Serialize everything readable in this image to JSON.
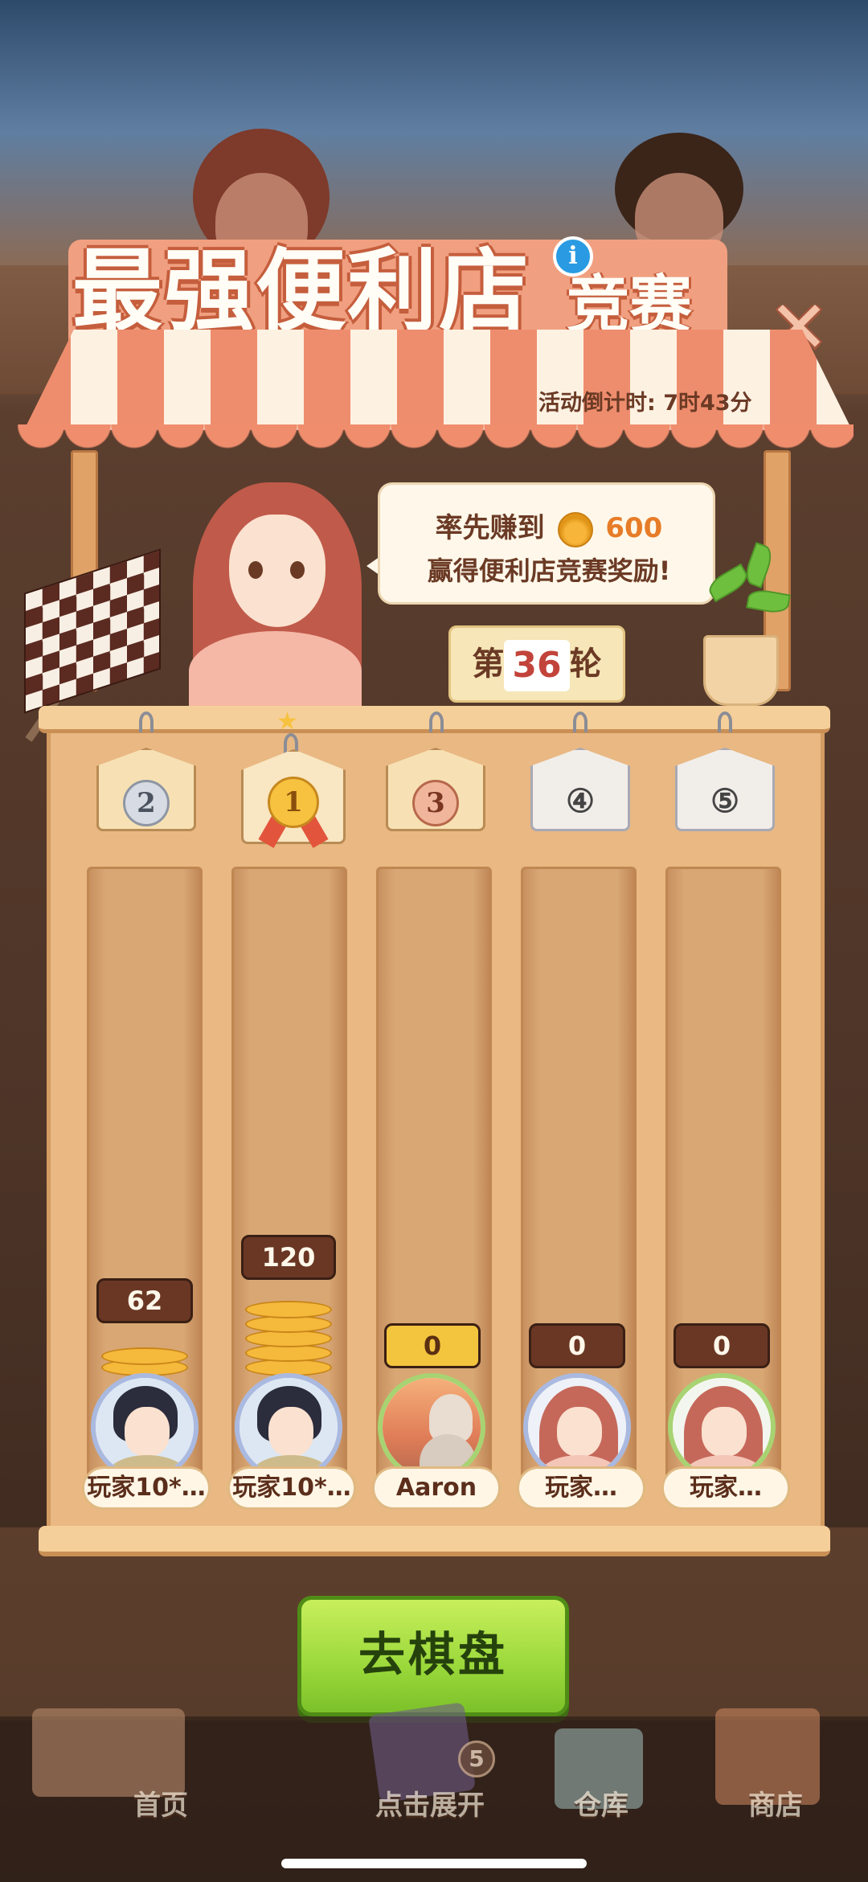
{
  "title": {
    "main": "最强便利店",
    "sub": "竞赛",
    "info_icon": "info-icon",
    "close_icon": "close-icon"
  },
  "countdown": "活动倒计时: 7时43分",
  "bubble": {
    "prefix": "率先赚到",
    "goal": "600",
    "line2": "赢得便利店竞赛奖励!",
    "currency_icon": "paw-coin-icon"
  },
  "round": {
    "prefix": "第",
    "number": "36",
    "suffix": "轮"
  },
  "players": [
    {
      "rank": "2",
      "score": "62",
      "name": "玩家10*…",
      "avatar": "male-avatar",
      "medal": "silver"
    },
    {
      "rank": "1",
      "score": "120",
      "name": "玩家10*…",
      "avatar": "male-avatar",
      "medal": "gold"
    },
    {
      "rank": "3",
      "score": "0",
      "name": "Aaron",
      "avatar": "sunset-avatar",
      "medal": "bronze"
    },
    {
      "rank": "④",
      "score": "0",
      "name": "玩家…",
      "avatar": "female-avatar",
      "medal": "plain"
    },
    {
      "rank": "⑤",
      "score": "0",
      "name": "玩家…",
      "avatar": "female-avatar",
      "medal": "plain"
    }
  ],
  "cta_label": "去棋盘",
  "nav": {
    "items": [
      {
        "label": "首页",
        "icon": "home-icon"
      },
      {
        "label": "点击展开",
        "icon": "cards-icon",
        "badge": "5"
      },
      {
        "label": "仓库",
        "icon": "warehouse-icon"
      },
      {
        "label": "商店",
        "icon": "shop-icon"
      }
    ]
  },
  "colors": {
    "awning_red": "#ee8d6d",
    "board_wood": "#e9b883",
    "cta_green": "#9ad83a",
    "score_dark": "#6a3724",
    "score_gold": "#f3c43d"
  }
}
